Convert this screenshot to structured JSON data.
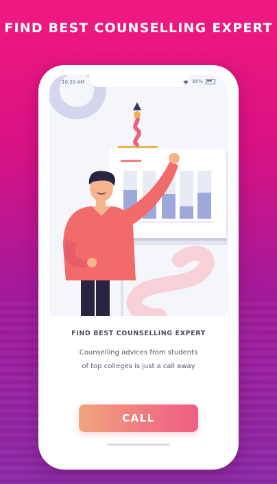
{
  "headline": "FIND BEST COUNSELLING EXPERT",
  "status": {
    "time": "10:30 AM",
    "battery": "85%"
  },
  "content": {
    "title": "FIND BEST COUNSELLING EXPERT",
    "line1": "Counselling advices from students",
    "line2": "of top colleges is just a call away"
  },
  "actions": {
    "call_label": "CALL"
  },
  "colors": {
    "bg_top": "#f0197f",
    "bg_bottom": "#8a2aa6",
    "button_start": "#f0a57d",
    "button_end": "#f05d82"
  },
  "icons": [
    "wifi-icon",
    "battery-icon"
  ]
}
